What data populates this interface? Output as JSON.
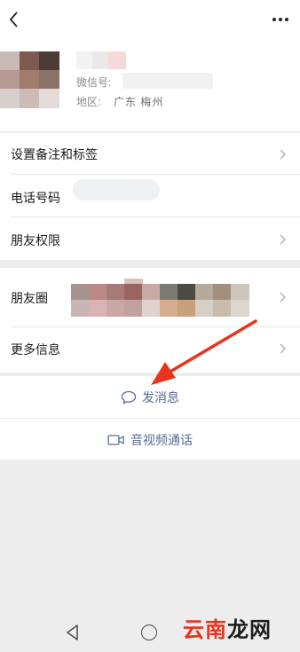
{
  "header": {
    "back_icon": "chevron-left-icon",
    "more_icon": "more-dots-icon",
    "wechat_id_label": "微信号:",
    "region_label": "地区:",
    "region_value": "广东  梅州"
  },
  "rows": {
    "remarks_tags": "设置备注和标签",
    "phone": "电话号码",
    "friend_permissions": "朋友权限",
    "moments": "朋友圈",
    "more_info": "更多信息"
  },
  "actions": {
    "send_message": "发消息",
    "video_call": "音视频通话"
  },
  "colors": {
    "link": "#576b95",
    "arrow": "#e8341c",
    "background": "#ededed"
  },
  "watermark": {
    "text1": "云南",
    "text2": "龙网"
  }
}
